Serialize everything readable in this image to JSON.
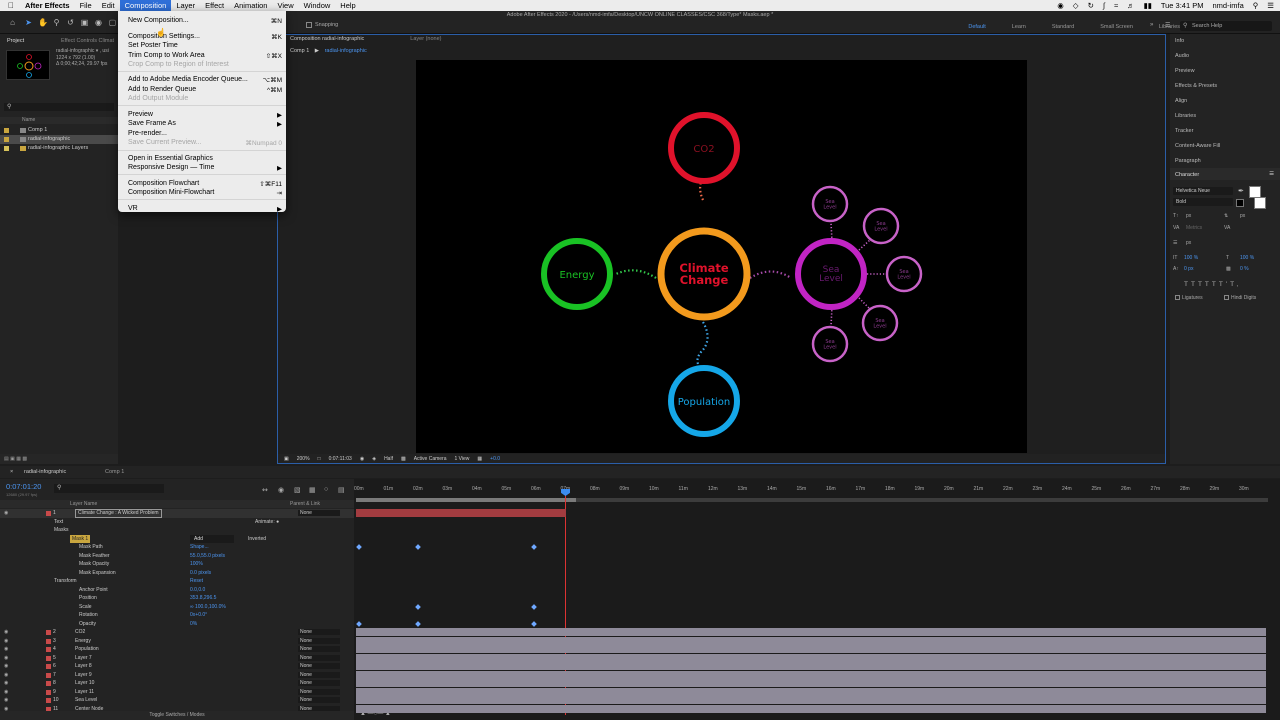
{
  "menubar": {
    "app": "After Effects",
    "items": [
      "File",
      "Edit",
      "Composition",
      "Layer",
      "Effect",
      "Animation",
      "View",
      "Window",
      "Help"
    ],
    "active": "Composition",
    "clock": "Tue 3:41 PM",
    "user": "nmd-imfa"
  },
  "window": {
    "title": "Adobe After Effects 2020 - /Users/nmd-imfa/Desktop/UNCW ONLINE CLASSES/CSC 368/Type* Masks.aep *",
    "snapping": "Snapping"
  },
  "workspaces": {
    "items": [
      "Default",
      "Learn",
      "Standard",
      "Small Screen",
      "Libraries"
    ],
    "active": "Default"
  },
  "search_help": {
    "placeholder": "Search Help"
  },
  "project": {
    "tab": "Project",
    "effect_tab": "Effect Controls Climat",
    "selected_name": "radial-infographic ▾ , usi",
    "info_line1": "1224 x 792 (1.00)",
    "info_line2": "Δ 0;00;42;24, 29.97 fps",
    "col_name": "Name",
    "items": [
      {
        "name": "Comp 1",
        "color": "#c9a63f",
        "selected": false
      },
      {
        "name": "radial-infographic",
        "color": "#c9a63f",
        "selected": true
      },
      {
        "name": "radial-infographic Layers",
        "color": "#d6c25a",
        "selected": false
      }
    ]
  },
  "menu": {
    "items": [
      {
        "label": "New Composition...",
        "shortcut": "⌘N",
        "disabled": false
      },
      {
        "label": "Composition Settings...",
        "shortcut": "⌘K",
        "disabled": false
      },
      {
        "label": "Set Poster Time",
        "shortcut": "",
        "disabled": false
      },
      {
        "label": "Trim Comp to Work Area",
        "shortcut": "⇧⌘X",
        "disabled": false
      },
      {
        "label": "Crop Comp to Region of Interest",
        "shortcut": "",
        "disabled": true
      },
      {
        "label": "Add to Adobe Media Encoder Queue...",
        "shortcut": "⌥⌘M",
        "disabled": false
      },
      {
        "label": "Add to Render Queue",
        "shortcut": "^⌘M",
        "disabled": false
      },
      {
        "label": "Add Output Module",
        "shortcut": "",
        "disabled": true
      },
      {
        "label": "Preview",
        "shortcut": "▶",
        "disabled": false
      },
      {
        "label": "Save Frame As",
        "shortcut": "▶",
        "disabled": false
      },
      {
        "label": "Pre-render...",
        "shortcut": "",
        "disabled": false
      },
      {
        "label": "Save Current Preview...",
        "shortcut": "⌘Numpad 0",
        "disabled": true
      },
      {
        "label": "Open in Essential Graphics",
        "shortcut": "",
        "disabled": false
      },
      {
        "label": "Responsive Design — Time",
        "shortcut": "▶",
        "disabled": false
      },
      {
        "label": "Composition Flowchart",
        "shortcut": "⇧⌘F11",
        "disabled": false
      },
      {
        "label": "Composition Mini-Flowchart",
        "shortcut": "⇥",
        "disabled": false
      },
      {
        "label": "VR",
        "shortcut": "▶",
        "disabled": false
      }
    ]
  },
  "composition": {
    "tab": "Composition radial-infographic",
    "layer_tab": "Layer (none)",
    "crumb1": "Comp 1",
    "crumb2": "radial-infographic",
    "viewer_bar": {
      "zoom": "200%",
      "time": "0:07:11:03",
      "resolution": "Half",
      "camera": "Active Camera",
      "views": "1 View",
      "exposure": "+0.0"
    },
    "nodes": {
      "center": "Climate\nChange",
      "co2": "CO2",
      "energy": "Energy",
      "population": "Population",
      "sea_level": "Sea\nLevel",
      "sea_small": "Sea\nLevel"
    },
    "colors": {
      "co2": "#e0122b",
      "energy": "#19c224",
      "population": "#15a7e8",
      "center": "#f39a1d",
      "sea": "#c124c4",
      "center_text": "#e0122b"
    }
  },
  "right_panels": {
    "items": [
      "Info",
      "Audio",
      "Preview",
      "Effects & Presets",
      "Align",
      "Libraries",
      "Tracker",
      "Content-Aware Fill",
      "Paragraph"
    ],
    "character": {
      "title": "Character",
      "font": "Helvetica Neue",
      "style": "Bold",
      "size_unit": "px",
      "metrics": "Metrics",
      "vscale": "100 %",
      "hscale": "100 %",
      "baseline": "0 px",
      "tsume": "0 %",
      "ligatures": "Ligatures",
      "hindi_digits": "Hindi Digits"
    }
  },
  "timeline": {
    "tabs": [
      "radial-infographic",
      "Comp 1"
    ],
    "timecode": "0:07:01:20",
    "frame_info": "12680 (29.97 fps)",
    "col_layer": "Layer Name",
    "col_parent": "Parent & Link",
    "ruler": [
      "00m",
      "01m",
      "02m",
      "03m",
      "04m",
      "05m",
      "06m",
      "07m",
      "08m",
      "09m",
      "10m",
      "11m",
      "12m",
      "13m",
      "14m",
      "15m",
      "16m",
      "17m",
      "18m",
      "19m",
      "20m",
      "21m",
      "22m",
      "23m",
      "24m",
      "25m",
      "26m",
      "27m",
      "28m",
      "29m",
      "30m"
    ],
    "footer": "Toggle Switches / Modes",
    "rows": [
      {
        "num": "1",
        "label": "Climate Change : A Wicked Problem",
        "value": "",
        "type": "layer",
        "color": "#c94a4a",
        "parent": "None"
      },
      {
        "num": "",
        "label": "Text",
        "value": "",
        "type": "group",
        "animate": "Animate: ●"
      },
      {
        "num": "",
        "label": "Masks",
        "value": "",
        "type": "group"
      },
      {
        "num": "",
        "label": "Mask 1",
        "value": "Add",
        "type": "mask",
        "inverted": "Inverted"
      },
      {
        "num": "",
        "label": "Mask Path",
        "value": "Shape...",
        "type": "prop"
      },
      {
        "num": "",
        "label": "Mask Feather",
        "value": "55.0,55.0 pixels",
        "type": "prop"
      },
      {
        "num": "",
        "label": "Mask Opacity",
        "value": "100%",
        "type": "prop"
      },
      {
        "num": "",
        "label": "Mask Expansion",
        "value": "0.0 pixels",
        "type": "prop"
      },
      {
        "num": "",
        "label": "Transform",
        "value": "Reset",
        "type": "group"
      },
      {
        "num": "",
        "label": "Anchor Point",
        "value": "0.0,0.0",
        "type": "prop"
      },
      {
        "num": "",
        "label": "Position",
        "value": "353.8,296.5",
        "type": "prop"
      },
      {
        "num": "",
        "label": "Scale",
        "value": "∞ 100.0,100.0%",
        "type": "prop"
      },
      {
        "num": "",
        "label": "Rotation",
        "value": "0x+0.0°",
        "type": "prop"
      },
      {
        "num": "",
        "label": "Opacity",
        "value": "0%",
        "type": "prop"
      },
      {
        "num": "2",
        "label": "CO2",
        "value": "",
        "type": "layer",
        "color": "#c94a4a",
        "parent": "None"
      },
      {
        "num": "3",
        "label": "Energy",
        "value": "",
        "type": "layer",
        "color": "#c94a4a",
        "parent": "None"
      },
      {
        "num": "4",
        "label": "Population",
        "value": "",
        "type": "layer",
        "color": "#c94a4a",
        "parent": "None"
      },
      {
        "num": "5",
        "label": "Layer 7",
        "value": "",
        "type": "layer",
        "color": "#c94a4a",
        "parent": "None"
      },
      {
        "num": "6",
        "label": "Layer 8",
        "value": "",
        "type": "layer",
        "color": "#c94a4a",
        "parent": "None"
      },
      {
        "num": "7",
        "label": "Layer 9",
        "value": "",
        "type": "layer",
        "color": "#c94a4a",
        "parent": "None"
      },
      {
        "num": "8",
        "label": "Layer 10",
        "value": "",
        "type": "layer",
        "color": "#c94a4a",
        "parent": "None"
      },
      {
        "num": "9",
        "label": "Layer 11",
        "value": "",
        "type": "layer",
        "color": "#c94a4a",
        "parent": "None"
      },
      {
        "num": "10",
        "label": "Sea Level",
        "value": "",
        "type": "layer",
        "color": "#c94a4a",
        "parent": "None"
      },
      {
        "num": "11",
        "label": "Center Node",
        "value": "",
        "type": "layer",
        "color": "#c94a4a",
        "parent": "None"
      }
    ]
  }
}
